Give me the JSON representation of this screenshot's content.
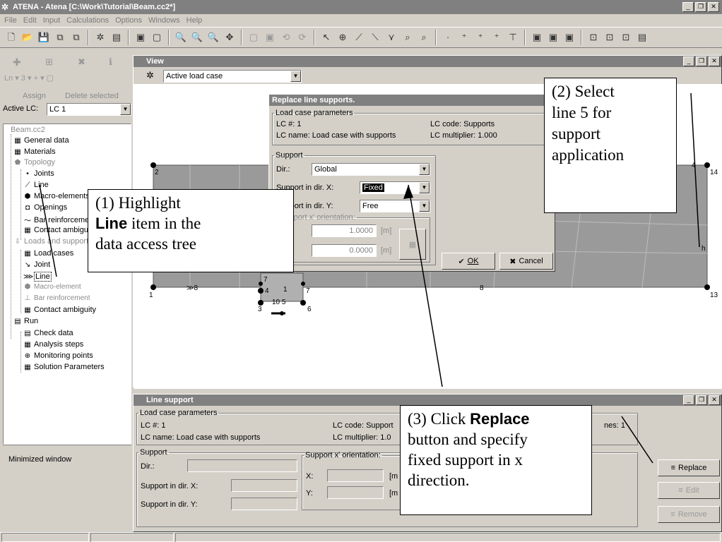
{
  "app": {
    "title": "ATENA - Atena [C:\\Work\\Tutorial\\Beam.cc2*]",
    "menu": [
      "File",
      "Edit",
      "Input",
      "Calculations",
      "Options",
      "Windows",
      "Help"
    ]
  },
  "left_panel": {
    "tools": {
      "assign": "Assign",
      "delete_selected": "Delete selected"
    },
    "active_lc_label": "Active LC:",
    "active_lc_value": "LC 1",
    "minimized_label": "Minimized window"
  },
  "tree": {
    "root": "Beam.cc2",
    "general_data": "General data",
    "materials": "Materials",
    "topology": "Topology",
    "joints": "Joints",
    "line": "Line",
    "macro_elements": "Macro-elements",
    "openings": "Openings",
    "bar_reinforcement": "Bar reinforcement",
    "contact_ambiguity": "Contact ambiguity",
    "loads_and_supports": "Loads and supports",
    "load_cases": "Load cases",
    "ls_joint": "Joint",
    "ls_line": "Line",
    "ls_macro_element": "Macro-element",
    "ls_bar_reinforcement": "Bar reinforcement",
    "ls_contact_ambiguity": "Contact ambiguity",
    "run": "Run",
    "check_data": "Check data",
    "analysis_steps": "Analysis steps",
    "monitoring_points": "Monitoring points",
    "solution_parameters": "Solution Parameters"
  },
  "view_window": {
    "title": "View",
    "combo_value": "Active load case",
    "joint_labels": [
      "1",
      "2",
      "3",
      "4",
      "5",
      "6",
      "7",
      "8",
      "13",
      "14"
    ],
    "line_labels": [
      "1",
      "8",
      "10",
      "11",
      "12"
    ]
  },
  "dialog": {
    "title": "Replace line supports.",
    "lc_params_legend": "Load case parameters",
    "lc_number": "LC #: 1",
    "lc_code": "LC code: Supports",
    "lc_name": "LC name: Load case with supports",
    "lc_multiplier": "LC multiplier: 1.000",
    "support_legend": "Support",
    "dir_label": "Dir.:",
    "dir_value": "Global",
    "support_x_label": "Support in dir. X:",
    "support_x_value": "Fixed",
    "support_y_label": "Support in dir. Y:",
    "support_y_value": "Free",
    "orientation_legend": "Support x' orientation:",
    "orient_x": "1.0000",
    "orient_y": "0.0000",
    "unit": "[m]",
    "ok_label": "OK",
    "cancel_label": "Cancel"
  },
  "line_support_window": {
    "title": "Line support",
    "lc_params_legend": "Load case parameters",
    "lc_number": "LC #: 1",
    "lc_name": "LC name: Load case with supports",
    "lc_code": "LC code: Support",
    "lc_multiplier": "LC multiplier: 1.0",
    "lines": "nes: 1",
    "support_legend": "Support",
    "dir_label": "Dir.:",
    "support_x_label": "Support in dir. X:",
    "support_y_label": "Support in dir. Y:",
    "orientation_legend": "Support x' orientation:",
    "x_label": "X:",
    "y_label": "Y:",
    "unit": "[m",
    "replace_label": "Replace",
    "edit_label": "Edit",
    "remove_label": "Remove"
  },
  "callouts": {
    "c1_a": "(1) Highlight",
    "c1_bold": "Line",
    "c1_b": " item in the",
    "c1_c": "data access tree",
    "c2": [
      "(2) Select",
      "line 5 for",
      "support",
      "application"
    ],
    "c3_a": "(3) Click ",
    "c3_bold": "Replace",
    "c3_b": "button and specify",
    "c3_c": "fixed support in x",
    "c3_d": "direction."
  }
}
